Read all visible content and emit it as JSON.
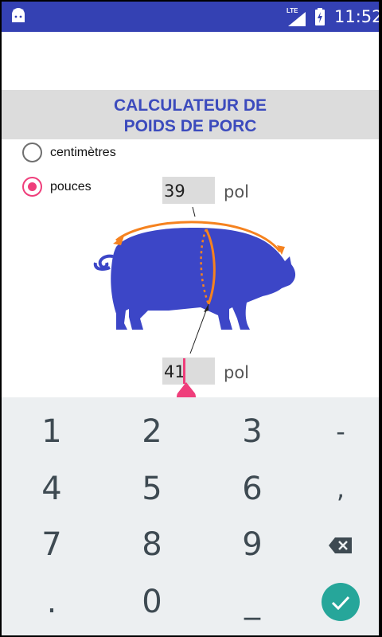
{
  "status_bar": {
    "time": "11:52",
    "network": "LTE",
    "icons": [
      "android-icon",
      "lte-signal-icon",
      "battery-charging-icon"
    ]
  },
  "header": {
    "title_line1": "CALCULATEUR DE",
    "title_line2": "POIDS DE PORC"
  },
  "units": {
    "options": [
      {
        "label": "centimètres",
        "checked": false
      },
      {
        "label": "pouces",
        "checked": true
      }
    ]
  },
  "measurements": {
    "length_value": "39",
    "length_unit": "pol",
    "girth_value": "41",
    "girth_unit": "pol"
  },
  "keyboard": {
    "rows": [
      [
        "1",
        "2",
        "3",
        "-"
      ],
      [
        "4",
        "5",
        "6",
        ","
      ],
      [
        "7",
        "8",
        "9",
        "backspace-icon"
      ],
      [
        ".",
        "0",
        "_",
        "check-icon"
      ]
    ],
    "accent": "#26a69a"
  },
  "colors": {
    "status_bar": "#3441b3",
    "title_text": "#3c4bbd",
    "pig": "#3c46c7",
    "arrows": "#f5821f",
    "radio_accent": "#ef3e7b"
  }
}
